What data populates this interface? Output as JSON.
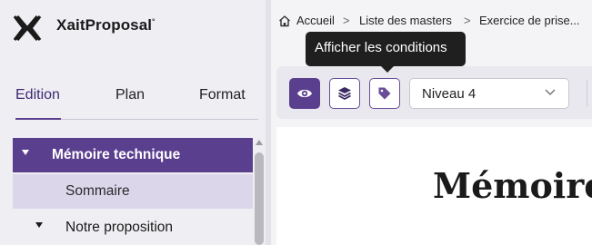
{
  "brand": {
    "name": "XaitProposal",
    "mark": "°"
  },
  "tabs": [
    {
      "label": "Edition",
      "active": true
    },
    {
      "label": "Plan",
      "active": false
    },
    {
      "label": "Format",
      "active": false
    }
  ],
  "tree": {
    "items": [
      {
        "label": "Mémoire technique",
        "state": "selected",
        "expanded": true
      },
      {
        "label": "Sommaire",
        "state": "child-highlighted"
      },
      {
        "label": "Notre proposition",
        "state": "expanded"
      }
    ]
  },
  "breadcrumb": {
    "items": [
      "Accueil",
      "Liste des masters",
      "Exercice de prise..."
    ],
    "separator": ">"
  },
  "toolbar": {
    "buttons": [
      "eye-icon",
      "layers-icon",
      "tag-icon"
    ],
    "level_select": {
      "value": "Niveau 4"
    }
  },
  "tooltip": {
    "text": "Afficher les conditions"
  },
  "document": {
    "title": "Mémoire"
  },
  "colors": {
    "accent": "#5b3f8f",
    "accent_light": "#dcd6ea",
    "panel_bg": "#efeef3",
    "tooltip_bg": "#1f1f1f"
  }
}
